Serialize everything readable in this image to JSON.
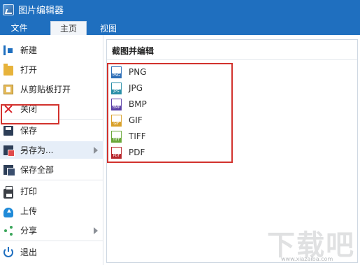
{
  "window": {
    "title": "图片编辑器"
  },
  "ribbon": {
    "tabs": [
      {
        "label": "文件"
      },
      {
        "label": "主页"
      },
      {
        "label": "视图"
      }
    ]
  },
  "menu": {
    "items": [
      {
        "label": "新建",
        "icon": "new-file-icon"
      },
      {
        "label": "打开",
        "icon": "folder-icon"
      },
      {
        "label": "从剪贴板打开",
        "icon": "clipboard-icon"
      },
      {
        "label": "关闭",
        "icon": "close-icon"
      },
      {
        "label": "保存",
        "icon": "save-icon"
      },
      {
        "label": "另存为...",
        "icon": "save-as-icon"
      },
      {
        "label": "保存全部",
        "icon": "save-all-icon"
      },
      {
        "label": "打印",
        "icon": "printer-icon"
      },
      {
        "label": "上传",
        "icon": "cloud-upload-icon"
      },
      {
        "label": "分享",
        "icon": "share-icon"
      },
      {
        "label": "退出",
        "icon": "power-icon"
      }
    ]
  },
  "panel": {
    "title": "截图并编辑",
    "formats": [
      {
        "label": "PNG",
        "tag": "PNG",
        "color": "#2f6fb7"
      },
      {
        "label": "JPG",
        "tag": "JPG",
        "color": "#2a8fa8"
      },
      {
        "label": "BMP",
        "tag": "BMP",
        "color": "#5a3fa6"
      },
      {
        "label": "GIF",
        "tag": "GIF",
        "color": "#d9a12b"
      },
      {
        "label": "TIFF",
        "tag": "TIFF",
        "color": "#6aa83a"
      },
      {
        "label": "PDF",
        "tag": "PDF",
        "color": "#b8272d"
      }
    ]
  },
  "watermark": {
    "text": "下载吧",
    "url": "www.xiazaiba.com"
  },
  "colors": {
    "titlebar": "#1f6fbf",
    "highlight": "#d2322d"
  }
}
